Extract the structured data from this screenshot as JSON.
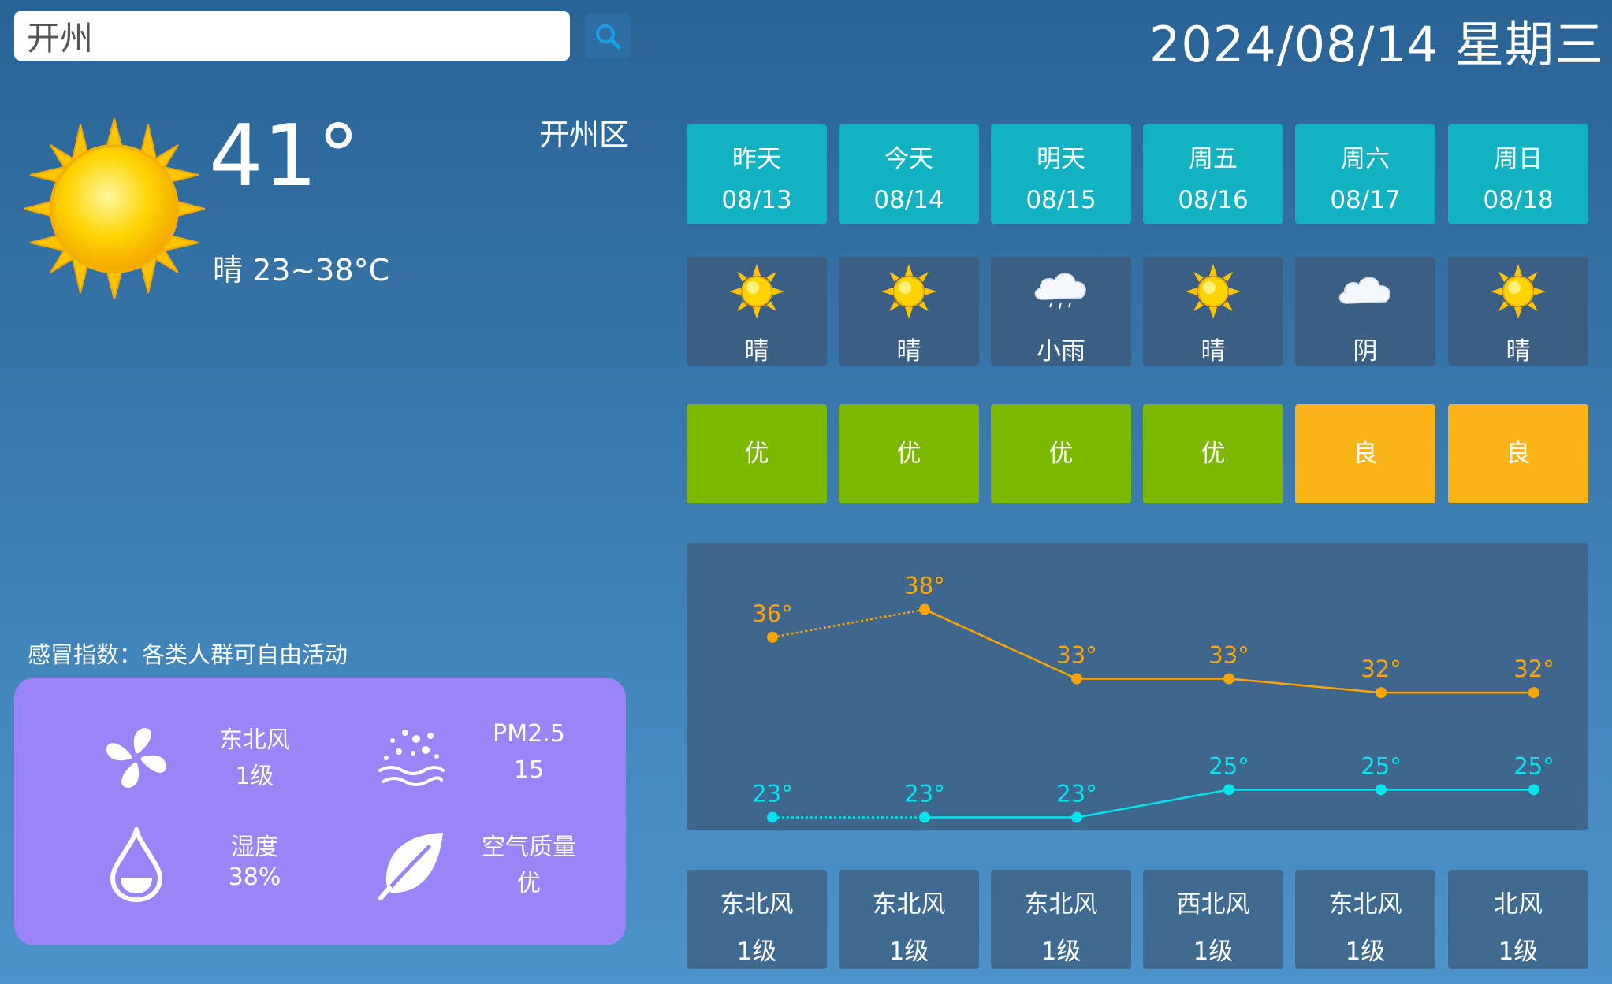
{
  "search": {
    "value": "开州"
  },
  "date": "2024/08/14 星期三",
  "current": {
    "temp": "41°",
    "desc": "晴 23~38°C",
    "district": "开州区",
    "cold_index": "感冒指数：各类人群可自由活动"
  },
  "info": {
    "wind_label": "东北风",
    "wind_value": "1级",
    "wind_icon": "fan-icon",
    "pm_label": "PM2.5",
    "pm_value": "15",
    "pm_icon": "particles-icon",
    "humidity_label": "湿度",
    "humidity_value": "38%",
    "humidity_icon": "water-drop-icon",
    "aq_label": "空气质量",
    "aq_value": "优",
    "aq_icon": "leaf-icon"
  },
  "days": [
    {
      "name": "昨天",
      "date": "08/13",
      "weather": "晴",
      "icon": "sun-icon",
      "aq": "优",
      "aq_color": "#7cb800",
      "wind": "东北风",
      "wind_level": "1级"
    },
    {
      "name": "今天",
      "date": "08/14",
      "weather": "晴",
      "icon": "sun-icon",
      "aq": "优",
      "aq_color": "#7cb800",
      "wind": "东北风",
      "wind_level": "1级"
    },
    {
      "name": "明天",
      "date": "08/15",
      "weather": "小雨",
      "icon": "rain-cloud-icon",
      "aq": "优",
      "aq_color": "#7cb800",
      "wind": "东北风",
      "wind_level": "1级"
    },
    {
      "name": "周五",
      "date": "08/16",
      "weather": "晴",
      "icon": "sun-icon",
      "aq": "优",
      "aq_color": "#7cb800",
      "wind": "西北风",
      "wind_level": "1级"
    },
    {
      "name": "周六",
      "date": "08/17",
      "weather": "阴",
      "icon": "cloud-icon",
      "aq": "良",
      "aq_color": "#fbb418",
      "wind": "东北风",
      "wind_level": "1级"
    },
    {
      "name": "周日",
      "date": "08/18",
      "weather": "晴",
      "icon": "sun-icon",
      "aq": "良",
      "aq_color": "#fbb418",
      "wind": "北风",
      "wind_level": "1级"
    }
  ],
  "colors": {
    "high": "#ffa500",
    "low": "#00e5ee"
  },
  "chart_data": {
    "type": "line",
    "categories": [
      "08/13",
      "08/14",
      "08/15",
      "08/16",
      "08/17",
      "08/18"
    ],
    "series": [
      {
        "values": [
          36,
          38,
          33,
          33,
          32,
          32
        ],
        "labels": [
          "36°",
          "38°",
          "33°",
          "33°",
          "32°",
          "32°"
        ]
      },
      {
        "values": [
          23,
          23,
          23,
          25,
          25,
          25
        ],
        "labels": [
          "23°",
          "23°",
          "23°",
          "25°",
          "25°",
          "25°"
        ]
      }
    ],
    "first_segment_dashed": true
  }
}
